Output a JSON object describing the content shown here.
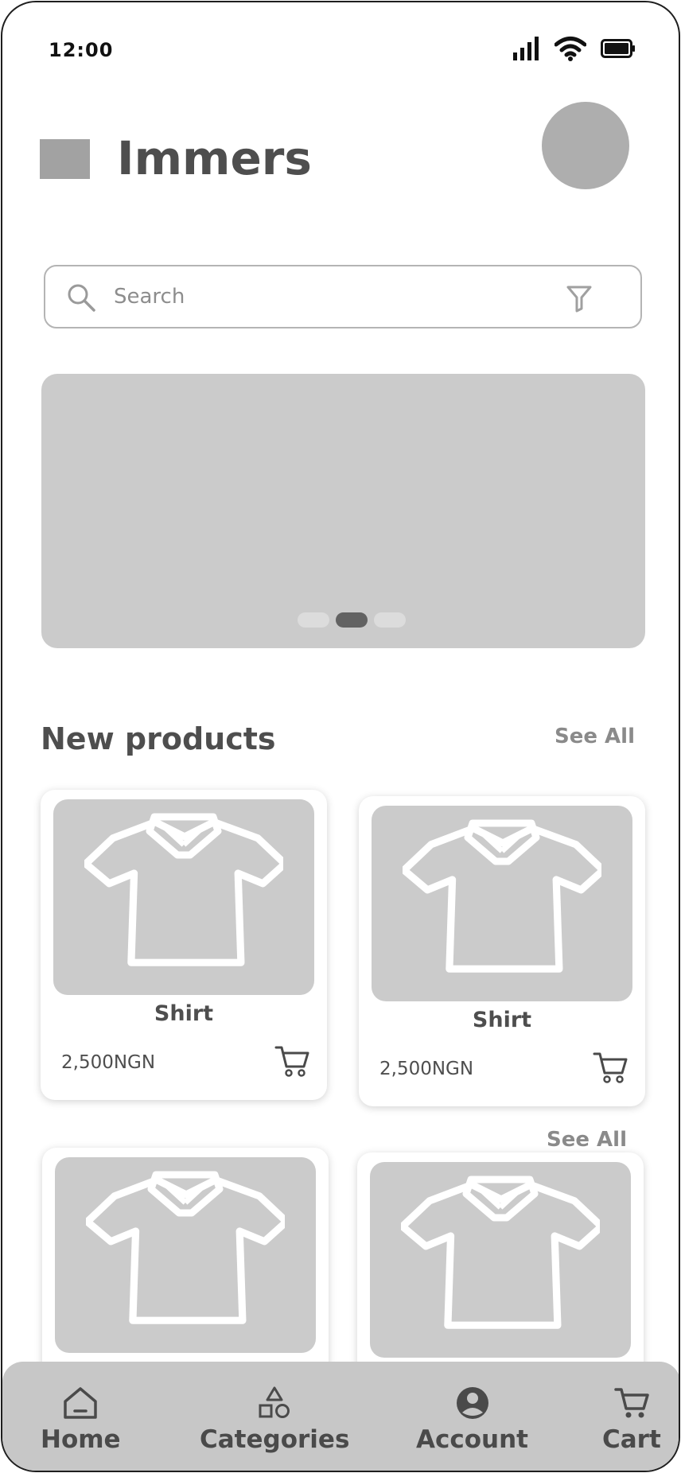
{
  "status_bar": {
    "time": "12:00"
  },
  "header": {
    "title": "Immers"
  },
  "search": {
    "placeholder": "Search"
  },
  "banner": {
    "dot_count": 3,
    "active_dot": 2
  },
  "new_products": {
    "title": "New products",
    "see_all": "See All",
    "see_all_secondary": "See All",
    "items": [
      {
        "name": "Shirt",
        "price": "2,500NGN"
      },
      {
        "name": "Shirt",
        "price": "2,500NGN"
      }
    ]
  },
  "bottom_nav": {
    "items": [
      {
        "label": "Home",
        "icon": "home-icon"
      },
      {
        "label": "Categories",
        "icon": "categories-icon"
      },
      {
        "label": "Account",
        "icon": "account-icon"
      },
      {
        "label": "Cart",
        "icon": "cart-icon"
      }
    ]
  },
  "colors": {
    "placeholder_gray": "#cbcbcb",
    "text_dark": "#4e4e4e",
    "nav_bg": "#c7c7c7"
  }
}
